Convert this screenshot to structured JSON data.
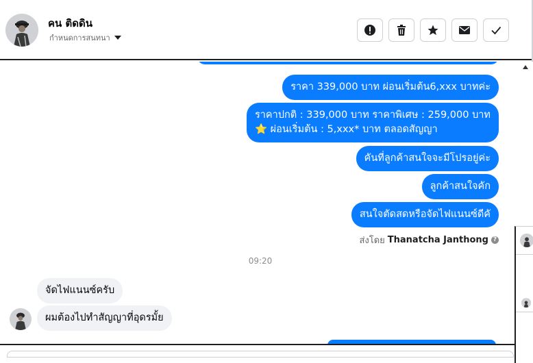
{
  "header": {
    "contact_name": "คน ติดดิน",
    "thread_menu_label": "กำหนดการสนทนา",
    "actions": [
      {
        "icon": "alert-icon"
      },
      {
        "icon": "trash-icon"
      },
      {
        "icon": "star-icon"
      },
      {
        "icon": "mail-icon"
      },
      {
        "icon": "check-icon"
      }
    ]
  },
  "messages": {
    "out_1": "ราคา 339,000 บาท ผ่อนเริ่มต้น6,xxx บาทค่ะ",
    "out_2_line1": "ราคาปกติ : 339,000 บาท ราคาพิเศษ : 259,000 บาท",
    "out_2_star": "⭐",
    "out_2_line2": "ผ่อนเริ่มต้น : 5,xxx* บาท ตลอดสัญญา",
    "out_3": "คันที่ลูกค้าสนใจจะมีโปรอยู่ค่ะ",
    "out_4": "ลูกค้าสนใจคัก",
    "out_5": "สนใจตัดสดหรือจัดไฟแนนซ์ดีคั",
    "sent_by_prefix": "ส่งโดย",
    "sent_by_name": "Thanatcha Janthong",
    "time": "09:20",
    "in_1": "จัดไฟแนนซ์ครับ",
    "in_2": "ผมต้องไปทำสัญญาที่อุดรมั้ย"
  },
  "colors": {
    "outgoing_bubble": "#0a7cff",
    "incoming_bubble": "#f0f2f5",
    "muted_text": "#65676b"
  }
}
